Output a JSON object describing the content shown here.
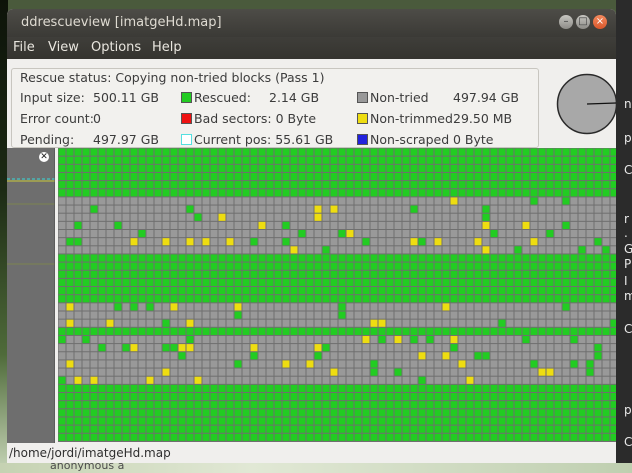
{
  "window": {
    "title": "ddrescueview [imatgeHd.map]",
    "controls": {
      "minimize": "–",
      "maximize": "□",
      "close": "×"
    }
  },
  "menu": [
    "File",
    "View",
    "Options",
    "Help"
  ],
  "status": {
    "title": "Rescue status:  Copying non-tried blocks (Pass 1)",
    "input_size_label": "Input size:",
    "input_size": "500.11 GB",
    "error_count_label": "Error count:",
    "error_count": "0",
    "pending_label": "Pending:",
    "pending": "497.97 GB",
    "rescued_label": "Rescued:",
    "rescued": "2.14 GB",
    "bad_sectors_label": "Bad sectors: 0 Byte",
    "current_pos_label": "Current pos: 55.61 GB",
    "non_tried_label": "Non-tried",
    "non_tried": "497.94 GB",
    "non_trimmed_label": "Non-trimmed",
    "non_trimmed": "29.50 MB",
    "non_scraped_label": "Non-scraped",
    "non_scraped": "0 Byte"
  },
  "legend_colors": {
    "rescued": "#22cc22",
    "bad_sectors": "#ee1111",
    "current_pos": "#55e0e0",
    "non_tried": "#999999",
    "non_trimmed": "#eedd11",
    "non_scraped": "#2222dd"
  },
  "map_path": "/home/jordi/imatgeHd.map",
  "desktop": {
    "right_edge_letters": [
      "n",
      "p",
      "C",
      "r",
      ".",
      "G",
      "P",
      "I",
      "m",
      "C",
      "p",
      "C"
    ],
    "bottom_text": "anonymous a"
  }
}
